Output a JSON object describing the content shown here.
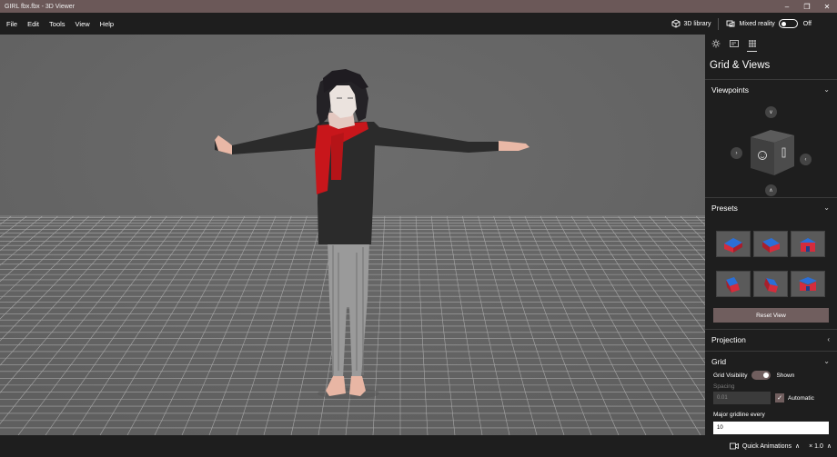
{
  "window": {
    "title": "GIRL fbx.fbx - 3D Viewer"
  },
  "menu": {
    "items": [
      "File",
      "Edit",
      "Tools",
      "View",
      "Help"
    ]
  },
  "toolbar": {
    "library_label": "3D library",
    "mixed_reality_label": "Mixed reality",
    "mixed_reality_state": "Off"
  },
  "panel": {
    "title": "Grid & Views",
    "viewpoints_label": "Viewpoints",
    "presets_label": "Presets",
    "reset_view_label": "Reset View",
    "projection_label": "Projection",
    "grid_label": "Grid",
    "grid_visibility_label": "Grid Visibility",
    "grid_visibility_state": "Shown",
    "spacing_label": "Spacing",
    "spacing_value": "0.01",
    "automatic_label": "Automatic",
    "major_gridline_label": "Major gridline every",
    "major_gridline_value": "10"
  },
  "status": {
    "quick_animations_label": "Quick Animations",
    "speed": "× 1.0"
  },
  "colors": {
    "accent": "#705e5e",
    "titlebar": "#6b5858",
    "viewport": "#6a6a6a",
    "scarf": "#c8161b"
  }
}
